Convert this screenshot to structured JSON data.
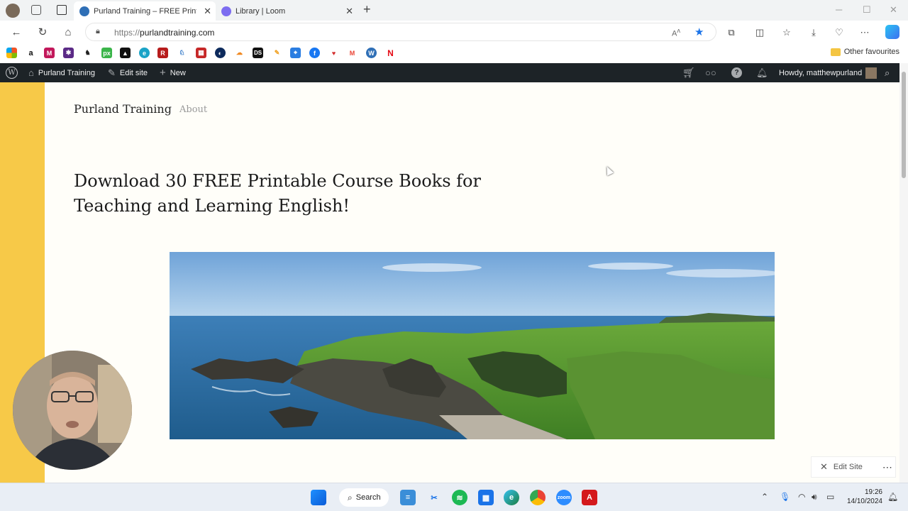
{
  "browser": {
    "tabs": [
      {
        "title": "Purland Training – FREE Printable",
        "active": true
      },
      {
        "title": "Library | Loom",
        "active": false
      }
    ],
    "url_proto": "https://",
    "url_host": "purlandtraining.com"
  },
  "bookmarks": {
    "other_label": "Other favourites"
  },
  "adminbar": {
    "site_name": "Purland Training",
    "edit_site": "Edit site",
    "new": "New",
    "howdy": "Howdy, matthewpurland"
  },
  "site": {
    "title": "Purland Training",
    "nav_about": "About",
    "headline": "Download 30 FREE Printable Course Books for Teaching and Learning English!",
    "edit_site_button": "Edit Site"
  },
  "taskbar": {
    "search_label": "Search",
    "time": "19:26",
    "date": "14/10/2024"
  },
  "colors": {
    "accent_yellow": "#f7c948",
    "admin_bar": "#1d2327"
  }
}
